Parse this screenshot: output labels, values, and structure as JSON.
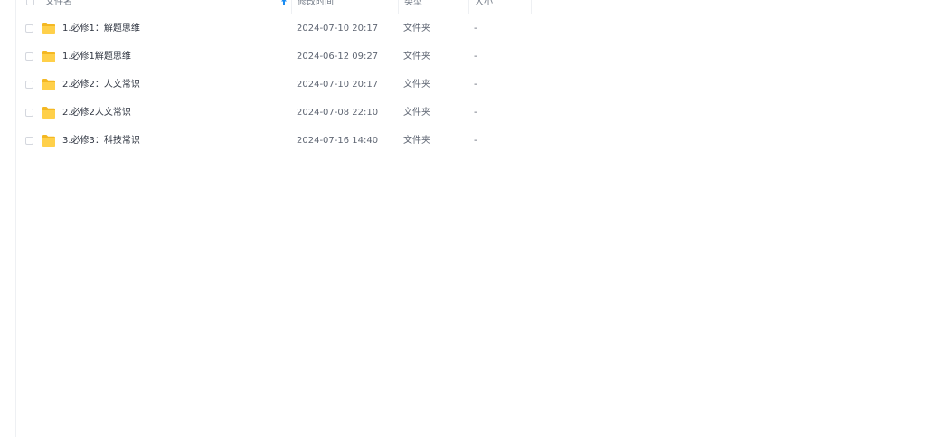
{
  "header": {
    "name_label": "文件名",
    "time_label": "修改时间",
    "type_label": "类型",
    "size_label": "大小",
    "sort_icon": "arrow-up-icon",
    "sort_color": "#1b8cf2"
  },
  "files": [
    {
      "name": "1.必修1：解题思维",
      "modified": "2024-07-10 20:17",
      "type": "文件夹",
      "size": "-",
      "icon": "folder-icon"
    },
    {
      "name": "1.必修1解题思维",
      "modified": "2024-06-12 09:27",
      "type": "文件夹",
      "size": "-",
      "icon": "folder-icon"
    },
    {
      "name": "2.必修2：人文常识",
      "modified": "2024-07-10 20:17",
      "type": "文件夹",
      "size": "-",
      "icon": "folder-icon"
    },
    {
      "name": "2.必修2人文常识",
      "modified": "2024-07-08 22:10",
      "type": "文件夹",
      "size": "-",
      "icon": "folder-icon"
    },
    {
      "name": "3.必修3：科技常识",
      "modified": "2024-07-16 14:40",
      "type": "文件夹",
      "size": "-",
      "icon": "folder-icon"
    }
  ],
  "colors": {
    "folder_back": "#f4b823",
    "folder_front": "#ffd04a",
    "header_text": "#737b87",
    "name_text": "#2e3440"
  }
}
